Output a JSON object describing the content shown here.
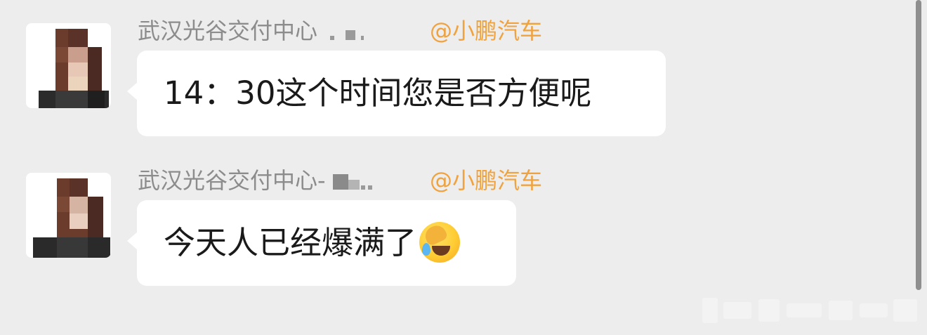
{
  "messages": [
    {
      "sender": "武汉光谷交付中心",
      "brand": "@小鹏汽车",
      "text": "14：30这个时间您是否方便呢"
    },
    {
      "sender": "武汉光谷交付中心-",
      "brand": "@小鹏汽车",
      "text": "今天人已经爆满了",
      "emoji": "face-palm-crying-emoji"
    }
  ],
  "icons": {
    "avatar": "avatar-pixelated"
  },
  "colors": {
    "background": "#ededed",
    "bubble": "#ffffff",
    "sender": "#8c8c8c",
    "brand": "#f0a23e"
  }
}
